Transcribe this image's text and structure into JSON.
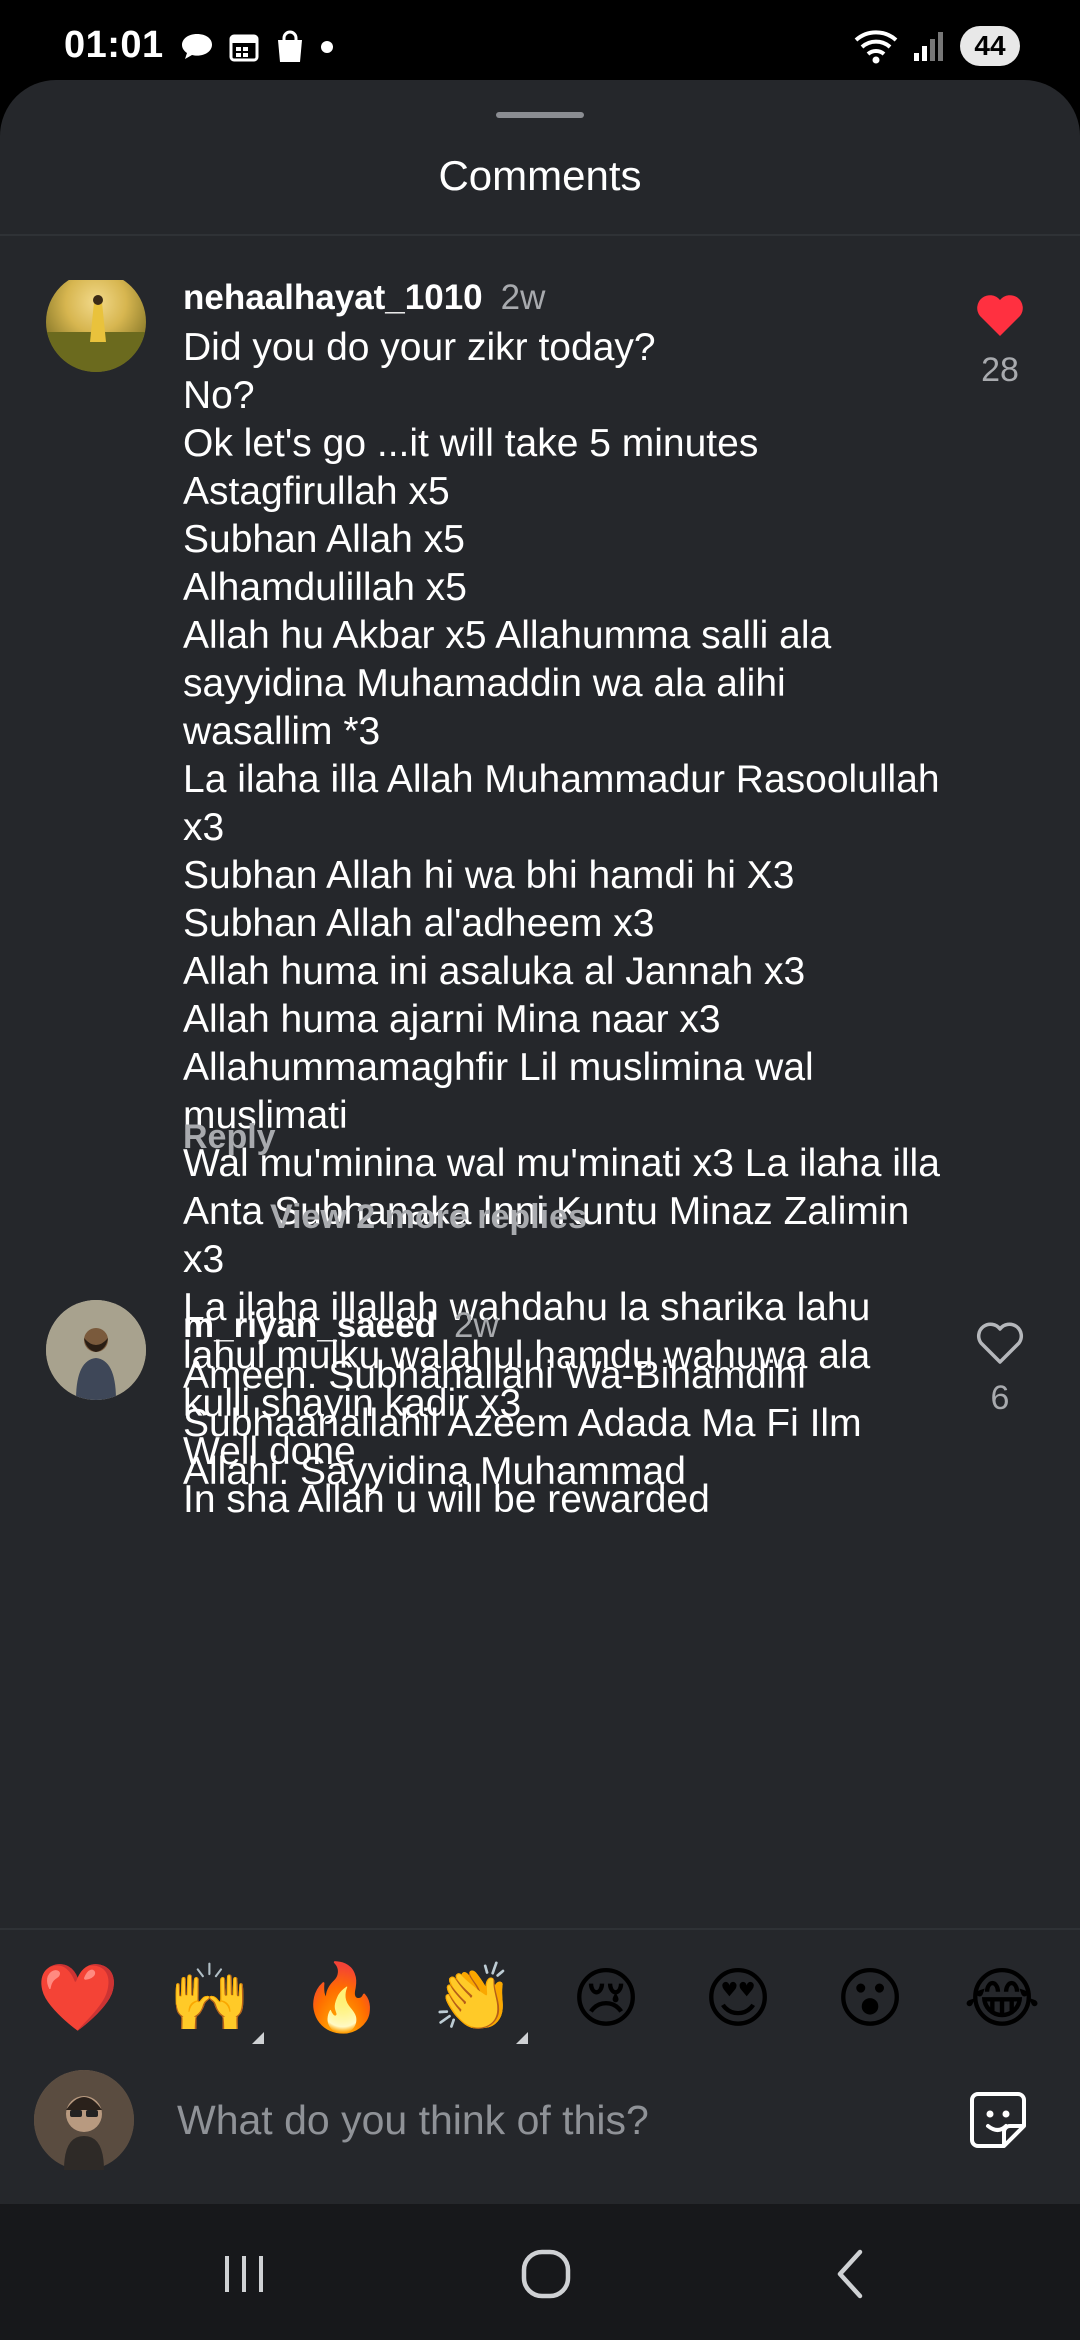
{
  "status_bar": {
    "time": "01:01",
    "battery": "44",
    "left_icons": [
      "chat-bubble-icon",
      "calendar-icon",
      "shopping-bag-icon",
      "dot-icon"
    ],
    "right_icons": [
      "wifi-icon",
      "signal-icon",
      "battery-icon"
    ]
  },
  "sheet": {
    "title": "Comments"
  },
  "comments": [
    {
      "username": "nehaalhayat_1010",
      "time": "2w",
      "text": "Did you do your zikr today?\nNo?\nOk let's go ...it will take 5 minutes\nAstagfirullah x5\nSubhan Allah x5\nAlhamdulillah x5\nAllah hu Akbar x5 Allahumma salli ala sayyidina Muhamaddin wa ala alihi wasallim *3\nLa ilaha illa Allah Muhammadur Rasoolullah x3\nSubhan Allah hi wa bhi hamdi hi X3\nSubhan Allah al'adheem x3\nAllah huma ini asaluka al Jannah x3\nAllah huma ajarni Mina naar x3\nAllahummamaghfir Lil muslimina wal muslimati\nWal mu'minina wal mu'minati x3 La ilaha illa Anta Subhanaka Inni Kuntu Minaz Zalimin x3\nLa ilaha illallah wahdahu la sharika lahu lahul mulku walahul hamdu wahuwa ala kulli shayin kadir x3\nWell done\nIn sha Allah u will be rewarded",
      "likes": "28",
      "liked": true,
      "reply_label": "Reply",
      "view_replies": "View 2 more replies"
    },
    {
      "username": "m_riyan_saeed",
      "time": "2w",
      "text": "Ameen. Subhanallahi Wa-Bihamdihi Subhaanallahil Azeem Adada Ma Fi Ilm Allahi. Sayyidina Muhammad",
      "likes": "6",
      "liked": false
    }
  ],
  "reactions": [
    "❤️",
    "🙌",
    "🔥",
    "👏",
    "😢",
    "😍",
    "😮",
    "😂"
  ],
  "input": {
    "placeholder": "What do you think of this?"
  },
  "nav": [
    "recents-icon",
    "home-icon",
    "back-icon"
  ],
  "colors": {
    "sheet_bg": "#25272b",
    "like_red": "#ff3040",
    "muted_text": "#a8aaae"
  }
}
